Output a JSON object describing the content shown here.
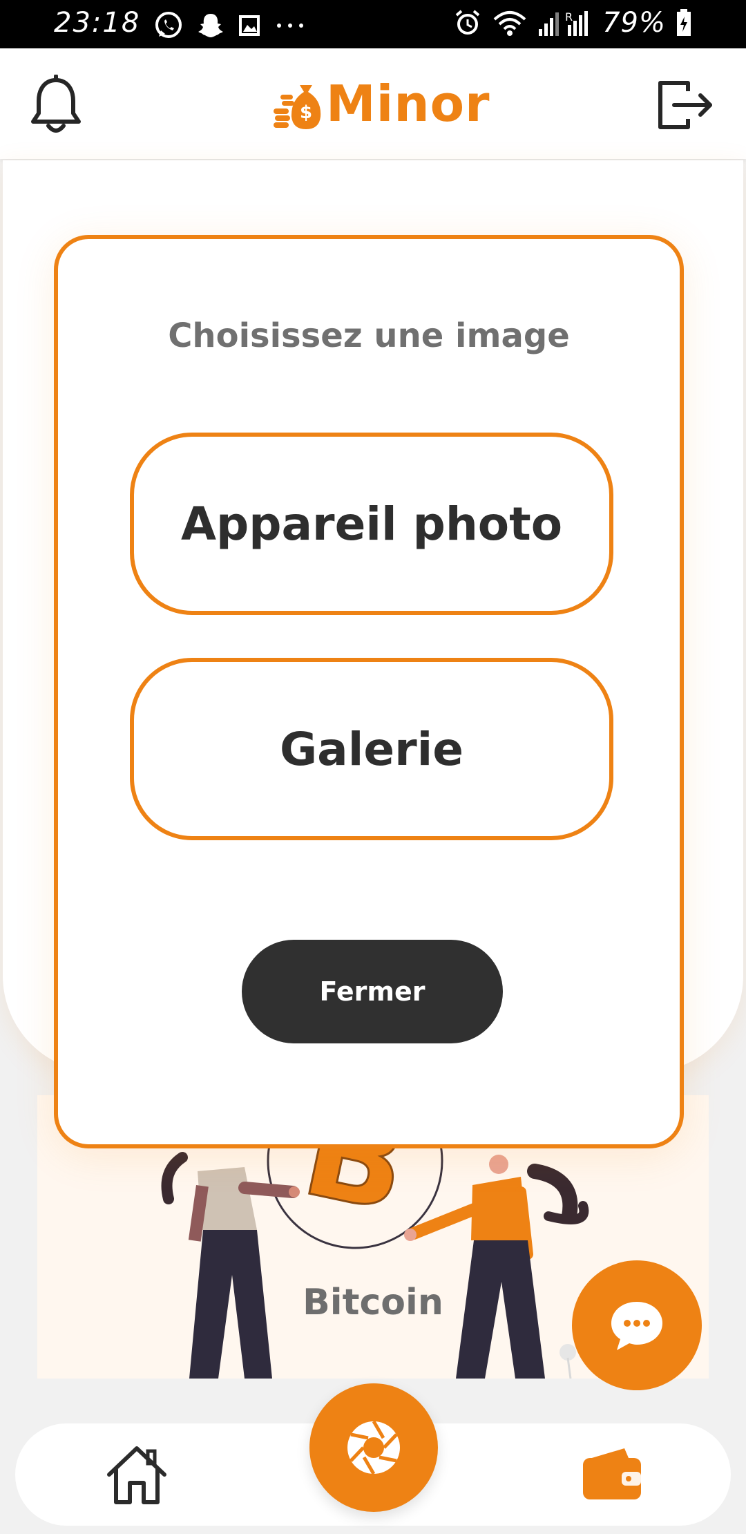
{
  "status_bar": {
    "time": "23:18",
    "battery": "79%"
  },
  "header": {
    "logo_text": "Minor",
    "left_icon": "bell-icon",
    "right_icon": "logout-icon"
  },
  "modal": {
    "title": "Choisissez une image",
    "camera_label": "Appareil photo",
    "gallery_label": "Galerie",
    "close_label": "Fermer"
  },
  "illustration": {
    "label": "Bitcoin"
  },
  "bottom_nav": {
    "items": [
      "home-icon",
      "camera-shutter-icon",
      "wallet-icon"
    ]
  },
  "colors": {
    "accent": "#ee8214",
    "dark": "#303030",
    "title_gray": "#707070"
  }
}
